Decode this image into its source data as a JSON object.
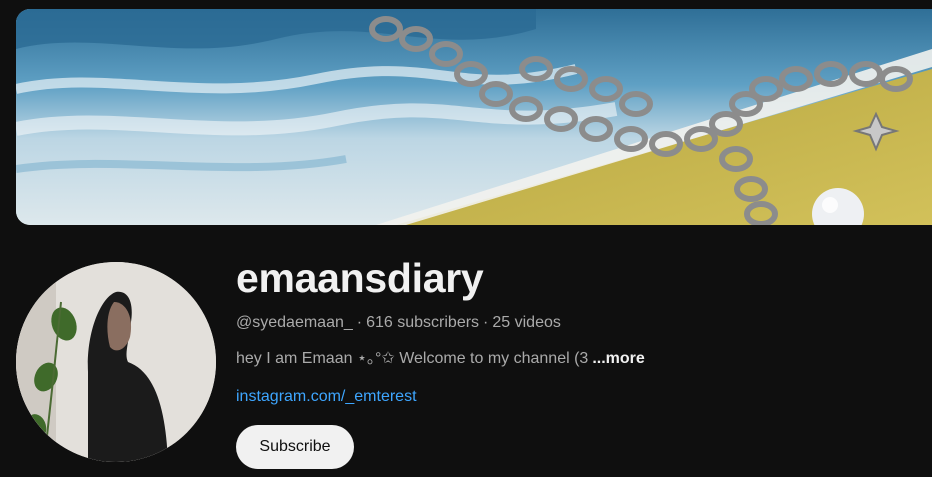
{
  "channel": {
    "name": "emaansdiary",
    "handle": "@syedaemaan_",
    "subscribers": "616 subscribers",
    "videos": "25 videos",
    "separator": "·",
    "description": "hey I am Emaan ⋆｡°✩ Welcome to my channel (3",
    "more_label": "...more",
    "link": "instagram.com/_emterest",
    "subscribe_label": "Subscribe"
  },
  "colors": {
    "background": "#0f0f0f",
    "primary_text": "#f1f1f1",
    "secondary_text": "#aaaaaa",
    "link": "#3ea6ff",
    "subscribe_bg": "#f1f1f1"
  },
  "images": {
    "banner": "banner-image",
    "avatar": "avatar-image"
  }
}
